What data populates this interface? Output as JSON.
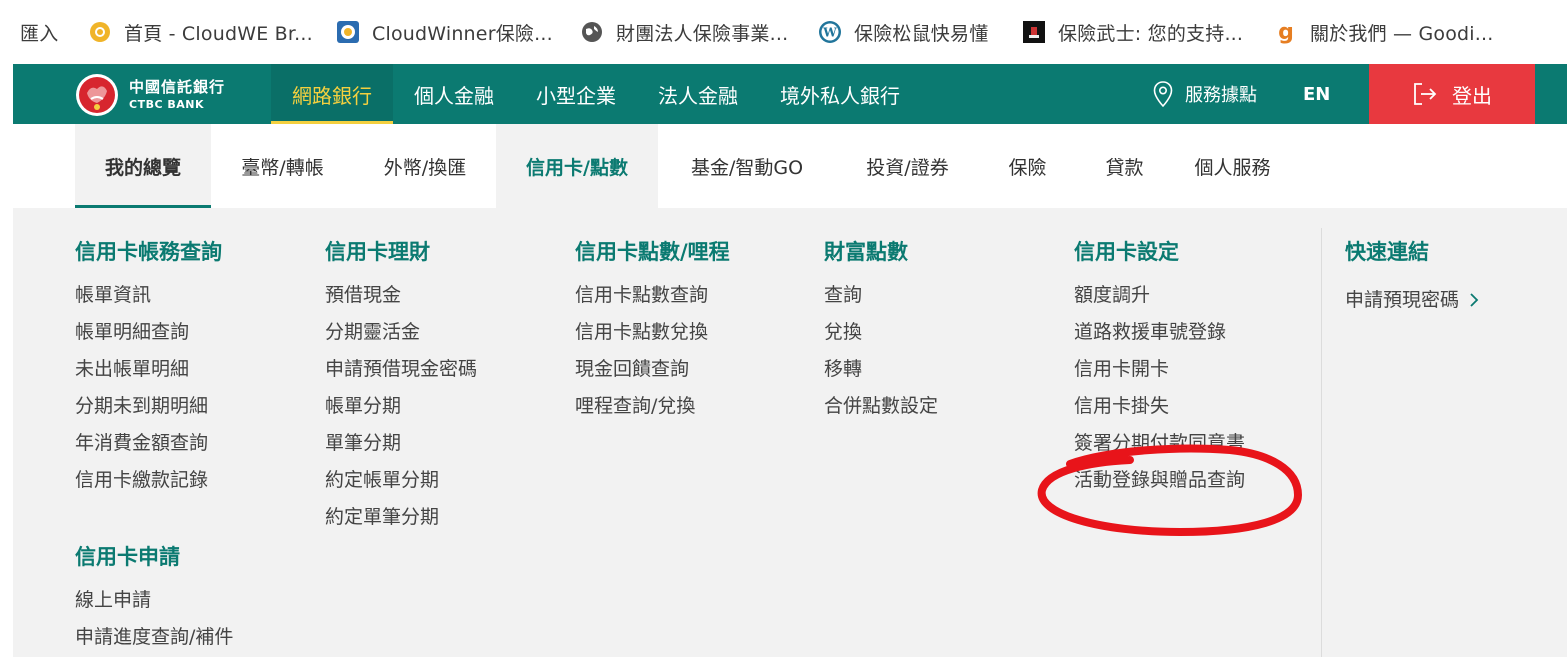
{
  "bookmarks": [
    {
      "label": "匯入",
      "icon": "none"
    },
    {
      "label": "首頁 - CloudWE Br...",
      "icon": "cloudwe-favicon-icon"
    },
    {
      "label": "CloudWinner保險...",
      "icon": "cloudwinner-favicon-icon"
    },
    {
      "label": "財團法人保險事業...",
      "icon": "globe-icon"
    },
    {
      "label": "保險松鼠快易懂",
      "icon": "wordpress-icon"
    },
    {
      "label": "保險武士: 您的支持...",
      "icon": "samurai-favicon-icon"
    },
    {
      "label": "關於我們 — Goodi...",
      "icon": "goodi-favicon-icon"
    }
  ],
  "brand": {
    "name_cn": "中國信託銀行",
    "name_en": "CTBC BANK"
  },
  "main_nav": [
    {
      "label": "網路銀行",
      "active": true
    },
    {
      "label": "個人金融",
      "active": false
    },
    {
      "label": "小型企業",
      "active": false
    },
    {
      "label": "法人金融",
      "active": false
    },
    {
      "label": "境外私人銀行",
      "active": false
    }
  ],
  "service_points": "服務據點",
  "lang": "EN",
  "logout": "登出",
  "sub_nav": [
    "我的總覽",
    "臺幣/轉帳",
    "外幣/換匯",
    "信用卡/點數",
    "基金/智動GO",
    "投資/證券",
    "保險",
    "貸款",
    "個人服務"
  ],
  "mega_menu": {
    "col1": {
      "title": "信用卡帳務查詢",
      "items": [
        "帳單資訊",
        "帳單明細查詢",
        "未出帳單明細",
        "分期未到期明細",
        "年消費金額查詢",
        "信用卡繳款記錄"
      ],
      "title2": "信用卡申請",
      "items2": [
        "線上申請",
        "申請進度查詢/補件"
      ]
    },
    "col2": {
      "title": "信用卡理財",
      "items": [
        "預借現金",
        "分期靈活金",
        "申請預借現金密碼",
        "帳單分期",
        "單筆分期",
        "約定帳單分期",
        "約定單筆分期"
      ]
    },
    "col3": {
      "title": "信用卡點數/哩程",
      "items": [
        "信用卡點數查詢",
        "信用卡點數兌換",
        "現金回饋查詢",
        "哩程查詢/兌換"
      ]
    },
    "col4": {
      "title": "財富點數",
      "items": [
        "查詢",
        "兌換",
        "移轉",
        "合併點數設定"
      ]
    },
    "col5": {
      "title": "信用卡設定",
      "items": [
        "額度調升",
        "道路救援車號登錄",
        "信用卡開卡",
        "信用卡掛失",
        "簽署分期付款同意書",
        "活動登錄與贈品查詢"
      ]
    },
    "col6": {
      "title": "快速連結",
      "items": [
        "申請預現密碼"
      ]
    }
  },
  "colors": {
    "brand_green": "#0b7a71",
    "active_yellow": "#f4d03f",
    "logout_red": "#e8393f",
    "highlight_red": "#e8141a"
  }
}
